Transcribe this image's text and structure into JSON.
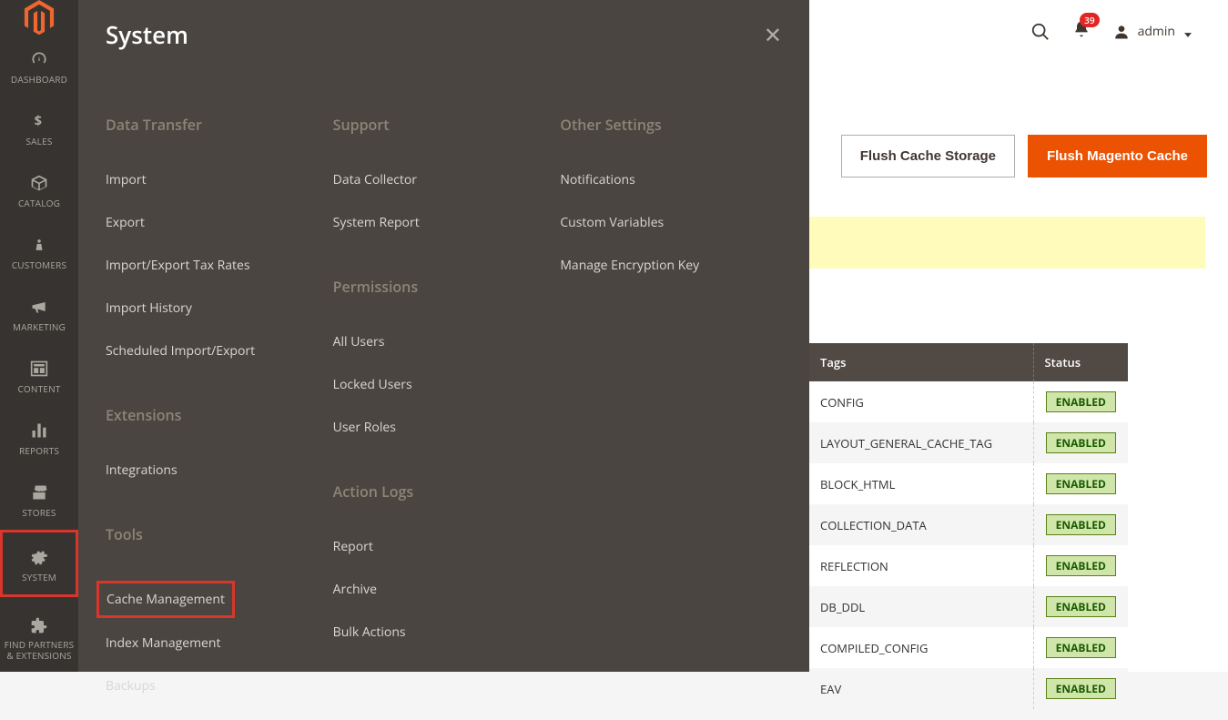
{
  "sidebar": {
    "items": [
      {
        "label": "DASHBOARD"
      },
      {
        "label": "SALES"
      },
      {
        "label": "CATALOG"
      },
      {
        "label": "CUSTOMERS"
      },
      {
        "label": "MARKETING"
      },
      {
        "label": "CONTENT"
      },
      {
        "label": "REPORTS"
      },
      {
        "label": "STORES"
      },
      {
        "label": "SYSTEM"
      },
      {
        "label": "FIND PARTNERS & EXTENSIONS"
      }
    ]
  },
  "flyout": {
    "title": "System",
    "col1": {
      "section1_title": "Data Transfer",
      "section1_links": [
        "Import",
        "Export",
        "Import/Export Tax Rates",
        "Import History",
        "Scheduled Import/Export"
      ],
      "section2_title": "Extensions",
      "section2_links": [
        "Integrations"
      ],
      "section3_title": "Tools",
      "section3_links": [
        "Cache Management",
        "Index Management",
        "Backups"
      ]
    },
    "col2": {
      "section1_title": "Support",
      "section1_links": [
        "Data Collector",
        "System Report"
      ],
      "section2_title": "Permissions",
      "section2_links": [
        "All Users",
        "Locked Users",
        "User Roles"
      ],
      "section3_title": "Action Logs",
      "section3_links": [
        "Report",
        "Archive",
        "Bulk Actions"
      ]
    },
    "col3": {
      "section1_title": "Other Settings",
      "section1_links": [
        "Notifications",
        "Custom Variables",
        "Manage Encryption Key"
      ]
    }
  },
  "topbar": {
    "notifications_count": "39",
    "username": "admin"
  },
  "buttons": {
    "flush_storage": "Flush Cache Storage",
    "flush_magento": "Flush Magento Cache"
  },
  "table": {
    "headers": {
      "tags": "Tags",
      "status": "Status"
    },
    "rows": [
      {
        "tag": "CONFIG",
        "status": "ENABLED"
      },
      {
        "tag": "LAYOUT_GENERAL_CACHE_TAG",
        "status": "ENABLED"
      },
      {
        "tag": "BLOCK_HTML",
        "status": "ENABLED"
      },
      {
        "tag": "COLLECTION_DATA",
        "status": "ENABLED"
      },
      {
        "tag": "REFLECTION",
        "status": "ENABLED"
      },
      {
        "tag": "DB_DDL",
        "status": "ENABLED"
      },
      {
        "tag": "COMPILED_CONFIG",
        "status": "ENABLED"
      },
      {
        "tag": "EAV",
        "status": "ENABLED"
      }
    ]
  }
}
